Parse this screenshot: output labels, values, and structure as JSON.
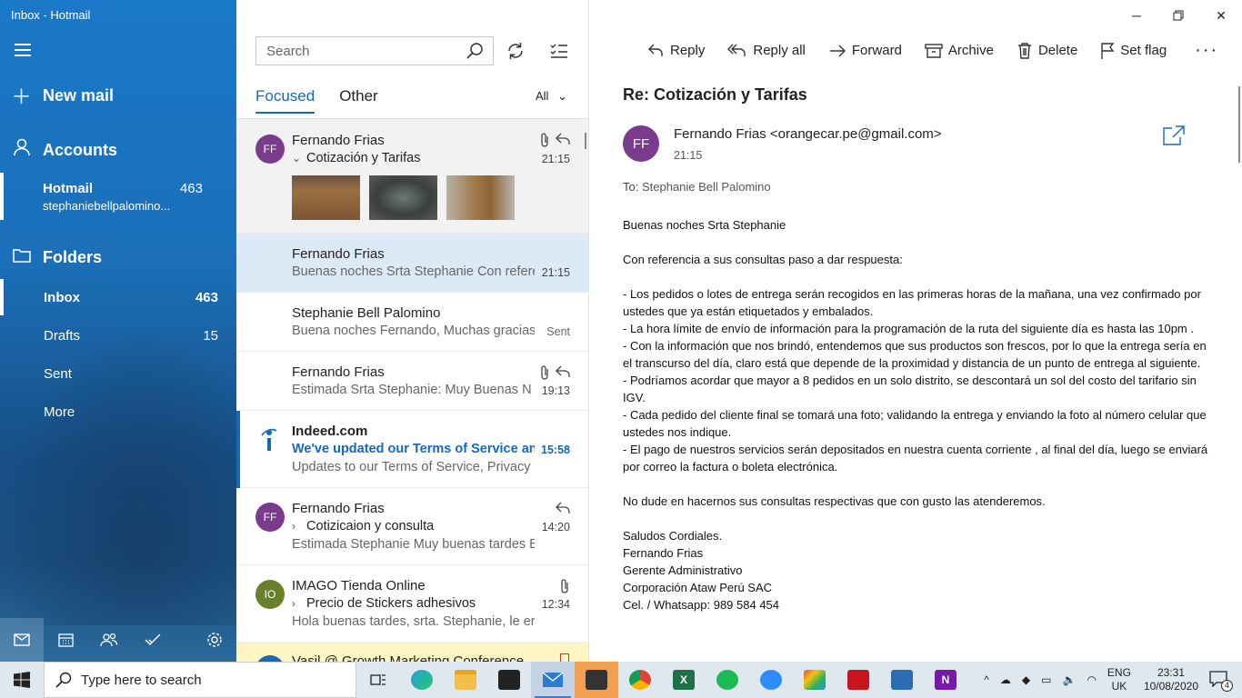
{
  "window": {
    "title": "Inbox - Hotmail"
  },
  "nav": {
    "new_mail": "New mail",
    "accounts": "Accounts",
    "account": {
      "name": "Hotmail",
      "count": "463",
      "email": "stephaniebellpalomino..."
    },
    "folders_label": "Folders",
    "folders": [
      {
        "name": "Inbox",
        "count": "463"
      },
      {
        "name": "Drafts",
        "count": "15"
      },
      {
        "name": "Sent",
        "count": ""
      },
      {
        "name": "More",
        "count": ""
      }
    ]
  },
  "list": {
    "search_placeholder": "Search",
    "tabs": [
      "Focused",
      "Other"
    ],
    "filter": "All",
    "messages": [
      {
        "initials": "FF",
        "sender": "Fernando Frias",
        "subject": "Cotización y Tarifas",
        "preview": "",
        "time": "21:15"
      },
      {
        "initials": "",
        "sender": "Fernando Frias",
        "subject": "",
        "preview": "Buenas noches Srta Stephanie Con referencia",
        "time": "21:15"
      },
      {
        "initials": "",
        "sender": "Stephanie Bell Palomino",
        "subject": "",
        "preview": "Buena noches Fernando, Muchas gracias",
        "time": "Sent"
      },
      {
        "initials": "",
        "sender": "Fernando Frias",
        "subject": "",
        "preview": "Estimada Srta Stephanie: Muy Buenas N",
        "time": "19:13"
      },
      {
        "initials": "",
        "sender": "Indeed.com",
        "subject": "We've updated our Terms of Service and",
        "preview": "Updates to our Terms of Service, Privacy",
        "time": "15:58"
      },
      {
        "initials": "FF",
        "sender": "Fernando Frias",
        "subject": "Cotizicaion y consulta",
        "preview": "Estimada Stephanie Muy buenas tardes E",
        "time": "14:20"
      },
      {
        "initials": "IO",
        "sender": "IMAGO Tienda Online",
        "subject": "Precio de Stickers adhesivos",
        "preview": "Hola buenas tardes, srta. Stephanie, le er",
        "time": "12:34"
      },
      {
        "initials": "",
        "sender": "Vasil @ Growth Marketing Conference",
        "subject": "",
        "preview": "",
        "time": ""
      }
    ]
  },
  "reader": {
    "commands": [
      "Reply",
      "Reply all",
      "Forward",
      "Archive",
      "Delete",
      "Set flag"
    ],
    "subject": "Re: Cotización y Tarifas",
    "initials": "FF",
    "from": "Fernando Frias <orangecar.pe@gmail.com>",
    "time": "21:15",
    "to_label": "To:",
    "to": "Stephanie Bell Palomino",
    "body": {
      "greeting": "Buenas noches Srta Stephanie",
      "intro": "Con referencia a sus consultas paso a dar respuesta:",
      "p1": "- Los pedidos o lotes de entrega serán recogidos en las primeras horas de la mañana, una vez confirmado por ustedes que ya están etiquetados y embalados.",
      "p2": "- La hora límite de envío de información para la programación de la ruta del siguiente día es hasta las 10pm .",
      "p3": "- Con la información que nos brindó, entendemos que sus productos son frescos, por lo que la entrega sería en el transcurso del día, claro está que depende de la proximidad y distancia de un punto de entrega al siguiente.",
      "p4": "- Podríamos acordar que mayor a 8 pedidos en un solo distrito, se descontará un sol del costo del tarifario sin IGV.",
      "p5": "- Cada pedido del cliente final se tomará una foto; validando la entrega y enviando la foto al número celular que ustedes nos indique.",
      "p6": "- El pago de nuestros servicios serán depositados en nuestra cuenta corriente , al final del día, luego se enviará por correo la factura o boleta electrónica.",
      "closing": "No dude en hacernos sus consultas respectivas que con gusto las atenderemos.",
      "sig1": "Saludos Cordiales.",
      "sig2": "Fernando Frias",
      "sig3": "Gerente Administrativo",
      "sig4": "Corporación Ataw Perú SAC",
      "sig5": "Cel. / Whatsapp: 989 584 454"
    }
  },
  "taskbar": {
    "search_placeholder": "Type here to search",
    "lang1": "ENG",
    "lang2": "UK",
    "time": "23:31",
    "date": "10/08/2020",
    "notifications": "4"
  },
  "colors": {
    "accent": "#1668b8",
    "nav_blue": "#1b6fb8",
    "selected_row": "#dceaf7",
    "hover_row": "#f2f2f2",
    "avatar_ff": "#7a3b8c",
    "avatar_io": "#6a7f2a",
    "indeed_bar": "#1668b8"
  }
}
